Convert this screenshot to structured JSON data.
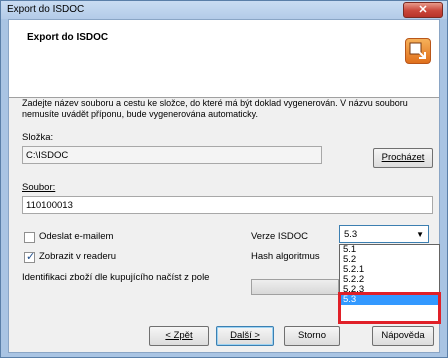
{
  "window": {
    "title": "Export do ISDOC",
    "close_label": "✕"
  },
  "header": {
    "title": "Export do ISDOC",
    "icon": "export-icon"
  },
  "description": "Zadejte název souboru a cestu ke složce, do které má být doklad vygenerován. V názvu souboru nemusíte uvádět příponu, bude vygenerována automaticky.",
  "folder": {
    "label": "Složka:",
    "value": "C:\\ISDOC",
    "browse_label": "Procházet"
  },
  "file": {
    "label": "Soubor:",
    "value": "110100013"
  },
  "options": {
    "send_email": {
      "label": "Odeslat e-mailem",
      "checked": false
    },
    "show_reader": {
      "label": "Zobrazit v readeru",
      "checked": true
    },
    "identify_label": "Identifikaci zboží dle kupujícího načíst z pole"
  },
  "version": {
    "label": "Verze ISDOC",
    "selected": "5.3",
    "options": [
      "5.1",
      "5.2",
      "5.2.1",
      "5.2.2",
      "5.2.3",
      "5.3"
    ],
    "highlighted": "5.3"
  },
  "hash": {
    "label": "Hash algoritmus"
  },
  "buttons": {
    "back": "< Zpět",
    "next": "Další >",
    "cancel": "Storno",
    "help": "Nápověda"
  }
}
